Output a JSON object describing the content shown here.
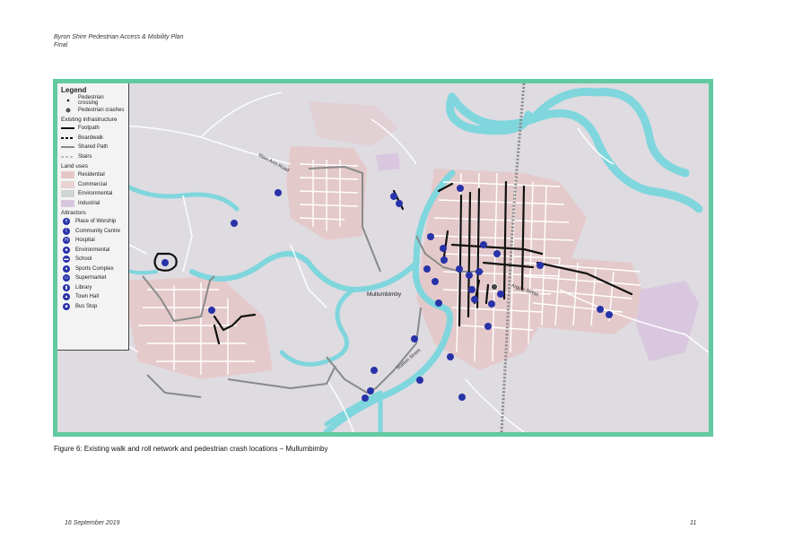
{
  "header": {
    "line1": "Byron Shire Pedestrian Access & Mobility Plan",
    "line2": "Final"
  },
  "map": {
    "town_label": "Mullumbimby",
    "street_labels": [
      "Main Arm Road",
      "Argyle Street",
      "Station Street"
    ],
    "colors": {
      "frame": "#62c9a0",
      "background": "#dedbe1",
      "river": "#7fd6dd",
      "residential": "#e6c7c7",
      "industrial": "#d9c7e0",
      "icon": "#2832a8"
    }
  },
  "legend": {
    "title": "Legend",
    "points": [
      {
        "label": "Pedestrian crossing",
        "icon": "small-dot"
      },
      {
        "label": "Pedestrian crashes",
        "icon": "grey-dot"
      }
    ],
    "infrastructure_title": "Existing infrastructure",
    "infrastructure": [
      {
        "label": "Footpath",
        "style": "solid-black"
      },
      {
        "label": "Boardwalk",
        "style": "dashed-black"
      },
      {
        "label": "Shared Path",
        "style": "solid-grey"
      },
      {
        "label": "Stairs",
        "style": "dashed-grey"
      }
    ],
    "land_title": "Land uses",
    "land": [
      {
        "label": "Residential",
        "color": "#e6c7c7"
      },
      {
        "label": "Commercial",
        "color": "#e8d2d2"
      },
      {
        "label": "Environmental",
        "color": "#cfd6d2"
      },
      {
        "label": "Industrial",
        "color": "#d9c7e0"
      }
    ],
    "attractors_title": "Attractors",
    "attractors": [
      {
        "label": "Place of Worship",
        "icon": "cross-icon",
        "glyph": "✝"
      },
      {
        "label": "Community Centre",
        "icon": "people-icon",
        "glyph": "Ϊ"
      },
      {
        "label": "Hospital",
        "icon": "hospital-icon",
        "glyph": "H"
      },
      {
        "label": "Environmental",
        "icon": "tree-icon",
        "glyph": "♣"
      },
      {
        "label": "School",
        "icon": "school-icon",
        "glyph": "▬"
      },
      {
        "label": "Sports Complex",
        "icon": "ball-icon",
        "glyph": "●"
      },
      {
        "label": "Supermarket",
        "icon": "cart-icon",
        "glyph": "▭"
      },
      {
        "label": "Library",
        "icon": "book-icon",
        "glyph": "▮"
      },
      {
        "label": "Town Hall",
        "icon": "hall-icon",
        "glyph": "▲"
      },
      {
        "label": "Bus Stop",
        "icon": "bus-icon",
        "glyph": "■"
      }
    ]
  },
  "caption": "Figure 6: Existing walk and roll network and pedestrian crash locations – Mullumbimby",
  "footer": {
    "date": "16 September 2019",
    "page": "11"
  }
}
